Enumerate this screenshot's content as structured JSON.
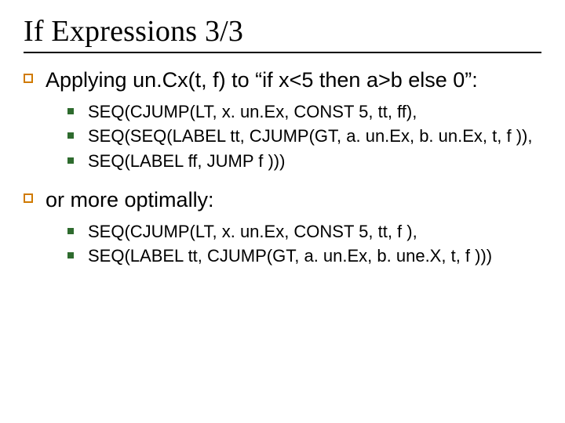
{
  "title": "If Expressions 3/3",
  "sections": [
    {
      "heading": "Applying un.Cx(t, f) to “if x<5 then a>b else 0”:",
      "items": [
        "SEQ(CJUMP(LT, x. un.Ex, CONST 5, tt, ff),",
        "SEQ(SEQ(LABEL tt, CJUMP(GT, a. un.Ex, b. un.Ex, t, f )),",
        "SEQ(LABEL ff, JUMP f )))"
      ]
    },
    {
      "heading": "or more optimally:",
      "items": [
        "SEQ(CJUMP(LT, x. un.Ex, CONST 5, tt, f ),",
        "SEQ(LABEL tt, CJUMP(GT, a. un.Ex, b. une.X, t, f )))"
      ]
    }
  ]
}
